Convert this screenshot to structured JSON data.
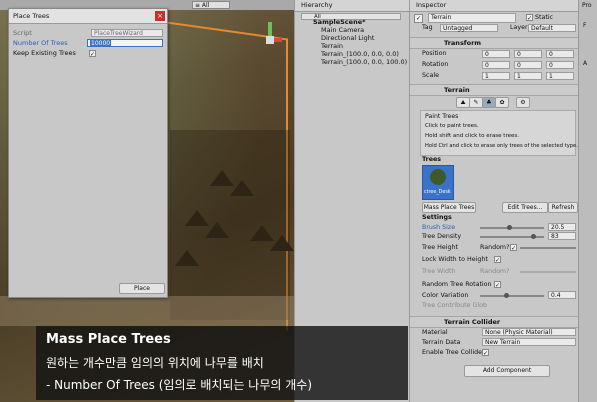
{
  "scene": {
    "toolbar_label": "≡ All"
  },
  "place_window": {
    "title": "Place Trees",
    "script_label": "Script",
    "script_value": "PlaceTreeWizard",
    "num_trees_label": "Number Of Trees",
    "num_trees_value": "10000",
    "keep_label": "Keep Existing Trees",
    "keep_value": "✓",
    "place_button": "Place"
  },
  "hierarchy": {
    "tab": "Hierarchy",
    "search": "All",
    "items": [
      "SampleScene*",
      "Main Camera",
      "Directional Light",
      "Terrain",
      "Terrain_(100.0, 0.0, 0.0)",
      "Terrain_(100.0, 0.0, 100.0)"
    ]
  },
  "inspector": {
    "tab": "Inspector",
    "object_name": "Terrain",
    "static_label": "Static",
    "tag_label": "Tag",
    "tag_value": "Untagged",
    "layer_label": "Layer",
    "layer_value": "Default",
    "transform": {
      "title": "Transform",
      "rows": [
        {
          "label": "Position",
          "x": "0",
          "y": "0",
          "z": "0"
        },
        {
          "label": "Rotation",
          "x": "0",
          "y": "0",
          "z": "0"
        },
        {
          "label": "Scale",
          "x": "1",
          "y": "1",
          "z": "1"
        }
      ]
    },
    "terrain": {
      "title": "Terrain",
      "help_title": "Paint Trees",
      "help_line1": "Click to paint trees.",
      "help_line2": "Hold shift and click to erase trees.",
      "help_line3": "Hold Ctrl and click to erase only trees of the selected type.",
      "trees_label": "Trees",
      "tree_caption": "ctree_Desk",
      "mass_place": "Mass Place Trees",
      "edit_trees": "Edit Trees...",
      "refresh": "Refresh",
      "settings_label": "Settings",
      "brush_size_label": "Brush Size",
      "brush_size_value": "20.5",
      "brush_size_frac": 0.45,
      "density_label": "Tree Density",
      "density_value": "83",
      "density_frac": 0.83,
      "height_label": "Tree Height",
      "random_label": "Random?",
      "lock_label": "Lock Width to Height",
      "width_label": "Tree Width",
      "random2_label": "Random?",
      "rot_label": "Random Tree Rotation",
      "color_label": "Color Variation",
      "color_value": "0.4",
      "color_frac": 0.4,
      "contrib_label": "Tree Contribute Glob"
    },
    "collider": {
      "title": "Terrain Collider",
      "material_label": "Material",
      "material_value": "None (Physic Material)",
      "data_label": "Terrain Data",
      "data_value": "New Terrain",
      "enable_label": "Enable Tree Colliders"
    },
    "add_component": "Add Component"
  },
  "far_right": {
    "labels": [
      "Pro",
      "F",
      "A"
    ]
  },
  "caption": {
    "line1": "Mass Place Trees",
    "line2": "원하는 개수만큼 임의의 위치에 나무를 배치",
    "line3": " - Number Of Trees (임의로 배치되는 나무의 개수)"
  },
  "colors": {
    "accent": "#e68a2e",
    "selection": "#3a72c8",
    "caption_bg": "#141414"
  }
}
